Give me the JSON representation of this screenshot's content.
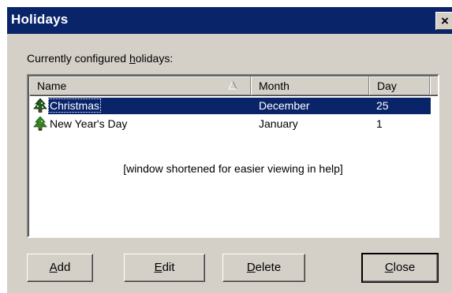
{
  "window": {
    "title": "Holidays",
    "close_glyph": "×"
  },
  "list": {
    "label_pre": "Currently configured ",
    "label_mnemonic": "h",
    "label_post": "olidays:",
    "columns": [
      {
        "label": "Name"
      },
      {
        "label": "Month"
      },
      {
        "label": "Day"
      }
    ],
    "sort_indicator": "ascending",
    "rows": [
      {
        "name": "Christmas",
        "month": "December",
        "day": "25",
        "icon": "christmas-tree-icon",
        "selected": true
      },
      {
        "name": "New Year's Day",
        "month": "January",
        "day": "1",
        "icon": "christmas-tree-icon",
        "selected": false
      }
    ],
    "note": "[window shortened for easier viewing in help]"
  },
  "buttons": {
    "add": {
      "mnemonic": "A",
      "rest": "dd"
    },
    "edit": {
      "mnemonic": "E",
      "rest": "dit"
    },
    "delete": {
      "mnemonic": "D",
      "rest": "elete"
    },
    "close": {
      "mnemonic": "C",
      "rest": "lose"
    }
  },
  "colors": {
    "titlebar": "#0a246a",
    "selection": "#0a246a",
    "face": "#d4d0c8"
  }
}
